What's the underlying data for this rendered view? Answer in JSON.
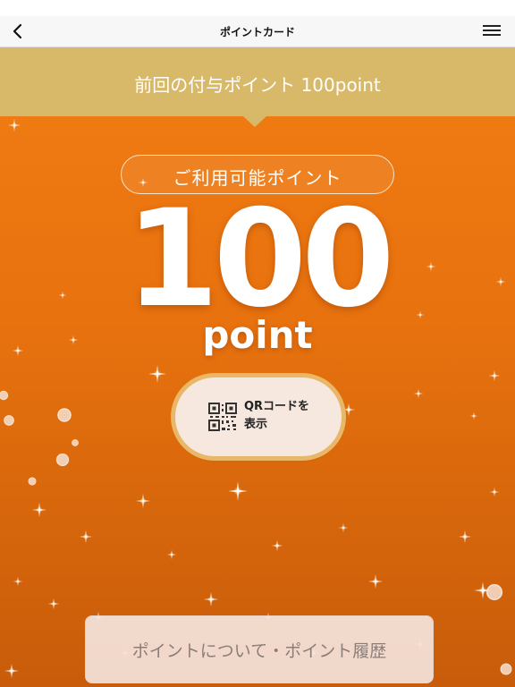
{
  "nav": {
    "title": "ポイントカード",
    "back_icon": "chevron-left-icon",
    "menu_icon": "hamburger-menu-icon"
  },
  "banner": {
    "text": "前回の付与ポイント 100point",
    "color": "#d8b96a"
  },
  "points": {
    "label": "ご利用可能ポイント",
    "value": "100",
    "unit": "point"
  },
  "qr_button": {
    "line1": "QRコードを",
    "line2": "表示",
    "icon": "qr-code-icon"
  },
  "history_button": {
    "label": "ポイントについて・ポイント履歴"
  },
  "colors": {
    "background_top": "#ef7a12",
    "background_bottom": "#c85c0a",
    "accent_gold": "#e8b868"
  }
}
